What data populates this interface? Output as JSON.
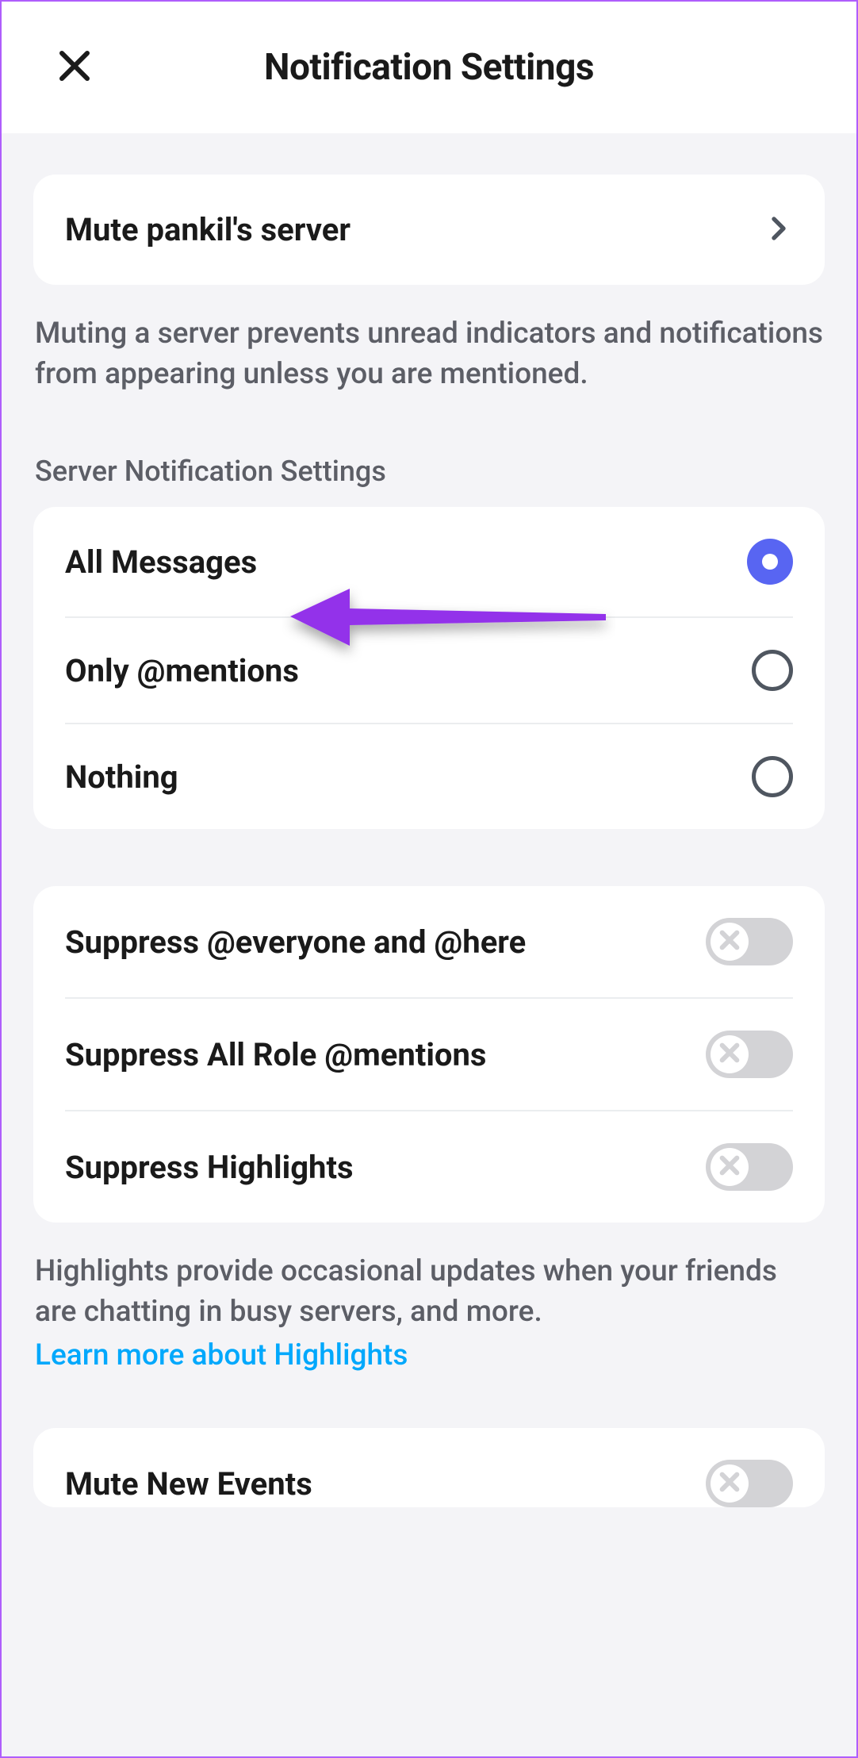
{
  "header": {
    "title": "Notification Settings"
  },
  "mute": {
    "label": "Mute pankil's server",
    "description": "Muting a server prevents unread indicators and notifications from appearing unless you are mentioned."
  },
  "serverSettings": {
    "title": "Server Notification Settings",
    "options": [
      {
        "label": "All Messages",
        "selected": true
      },
      {
        "label": "Only @mentions",
        "selected": false
      },
      {
        "label": "Nothing",
        "selected": false
      }
    ]
  },
  "toggles": [
    {
      "label": "Suppress @everyone and @here",
      "on": false
    },
    {
      "label": "Suppress All Role @mentions",
      "on": false
    },
    {
      "label": "Suppress Highlights",
      "on": false
    }
  ],
  "highlights": {
    "description": "Highlights provide occasional updates when your friends are chatting in busy servers, and more.",
    "link": "Learn more about Highlights"
  },
  "events": {
    "label": "Mute New Events"
  }
}
